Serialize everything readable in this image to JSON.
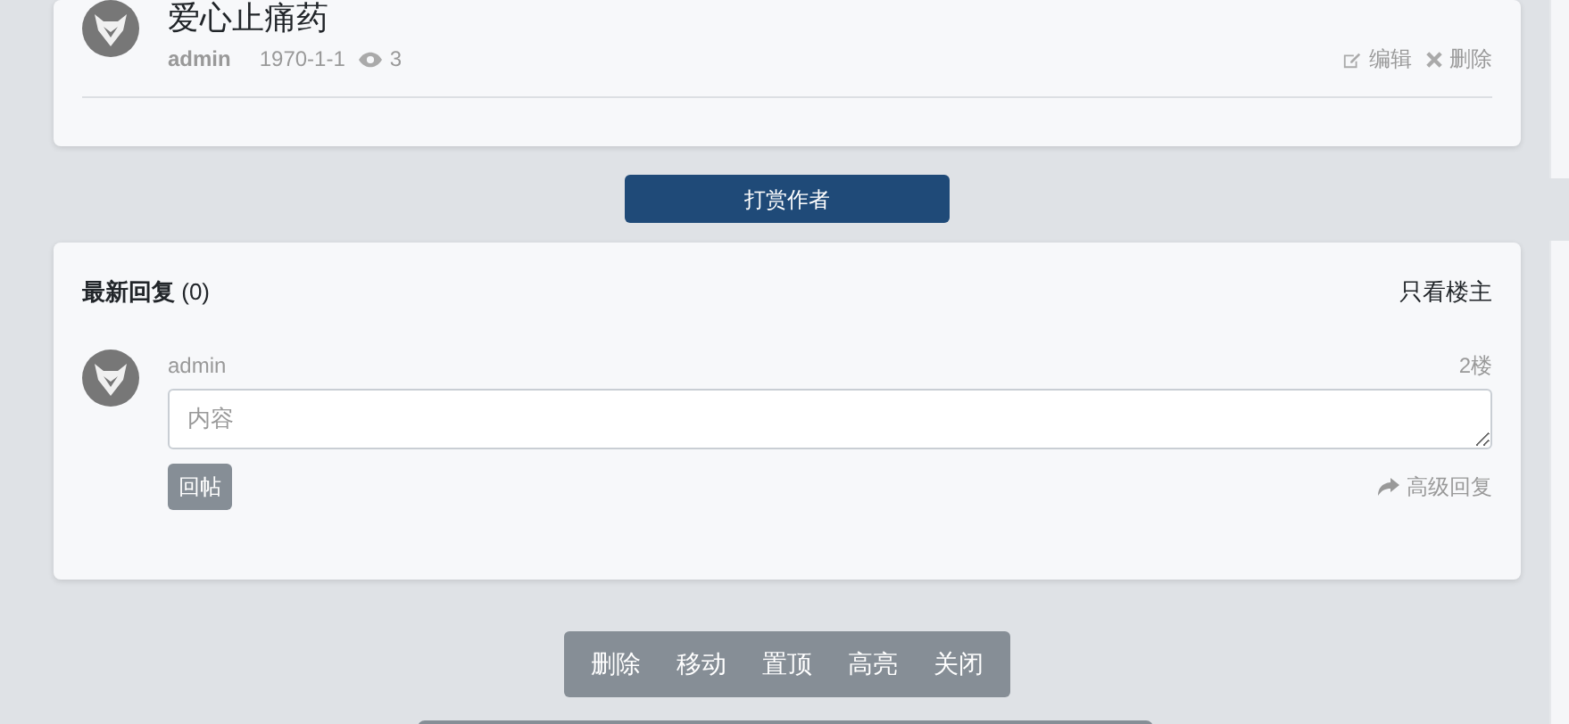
{
  "post": {
    "title": "爱心止痛药",
    "author": "admin",
    "date": "1970-1-1",
    "views": "3",
    "actions": [
      {
        "kind": "edit",
        "label": "编辑"
      },
      {
        "kind": "delete",
        "label": "删除"
      }
    ]
  },
  "reward_button": "打赏作者",
  "replies": {
    "title": "最新回复",
    "count": "(0)",
    "filter": "只看楼主",
    "form": {
      "author": "admin",
      "floor": "2楼",
      "placeholder": "内容",
      "submit": "回帖",
      "advanced": "高级回复"
    }
  },
  "moderation": [
    "删除",
    "移动",
    "置顶",
    "高亮",
    "关闭"
  ]
}
